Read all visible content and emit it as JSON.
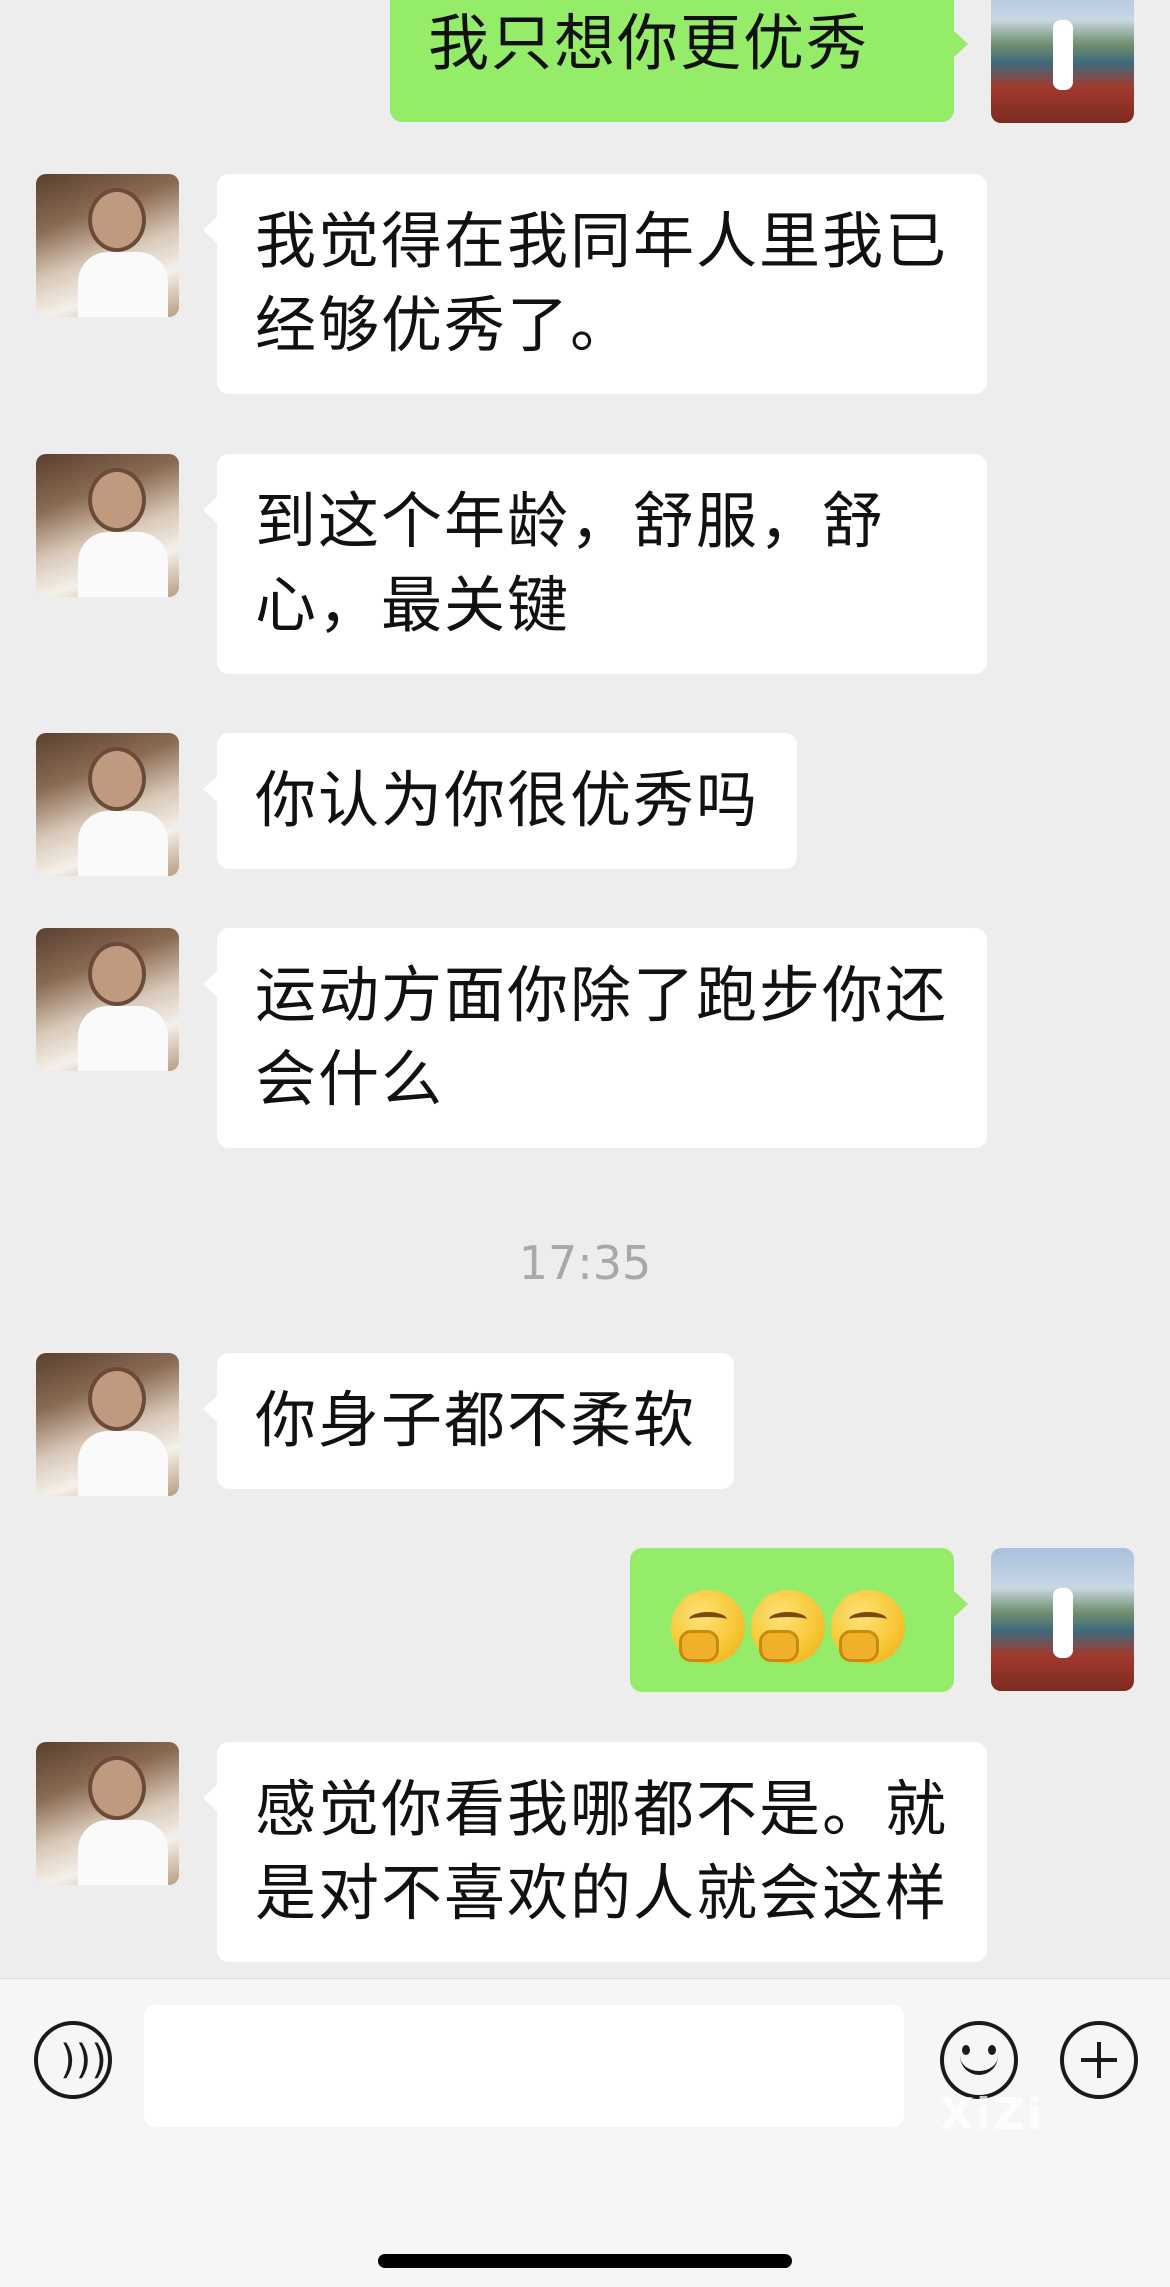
{
  "messages": [
    {
      "side": "right",
      "text": "我只想你更优秀"
    },
    {
      "side": "left",
      "text": "我觉得在我同年人里我已经够优秀了。"
    },
    {
      "side": "left",
      "text": "到这个年龄，舒服，舒心，最关键"
    },
    {
      "side": "left",
      "text": "你认为你很优秀吗"
    },
    {
      "side": "left",
      "text": "运动方面你除了跑步你还会什么"
    },
    {
      "side": "left",
      "text": "你身子都不柔软"
    },
    {
      "side": "right",
      "emoji": [
        "thinking-face",
        "thinking-face",
        "thinking-face"
      ]
    },
    {
      "side": "left",
      "text": "感觉你看我哪都不是。就是对不喜欢的人就会这样"
    }
  ],
  "timestamp": "17:35",
  "composer": {
    "voice_icon": "voice-icon",
    "emoji_icon": "smiley-icon",
    "plus_icon": "plus-icon",
    "input_value": "",
    "watermark": "XiZi"
  }
}
